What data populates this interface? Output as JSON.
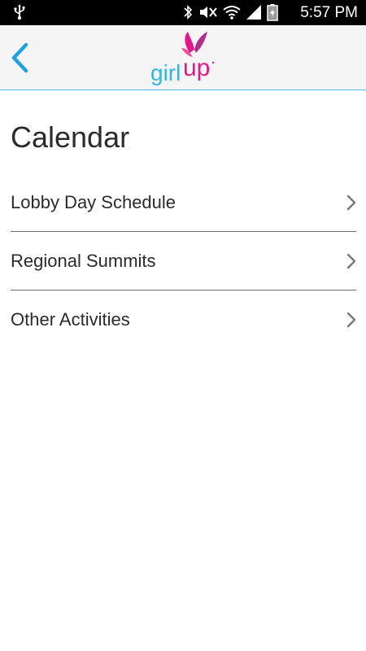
{
  "status_bar": {
    "time": "5:57 PM",
    "icons": [
      "usb-icon",
      "bluetooth-icon",
      "mute-icon",
      "wifi-icon",
      "signal-icon",
      "battery-charging-icon"
    ]
  },
  "header": {
    "back_icon": "chevron-left-icon",
    "logo_text": "girlup",
    "accent_color": "#54b6e6",
    "logo_pink": "#e6178a",
    "logo_blue": "#37b4e4"
  },
  "main": {
    "title": "Calendar",
    "items": [
      {
        "label": "Lobby Day Schedule",
        "icon": "chevron-right-icon"
      },
      {
        "label": "Regional Summits",
        "icon": "chevron-right-icon"
      },
      {
        "label": "Other Activities",
        "icon": "chevron-right-icon"
      }
    ]
  }
}
